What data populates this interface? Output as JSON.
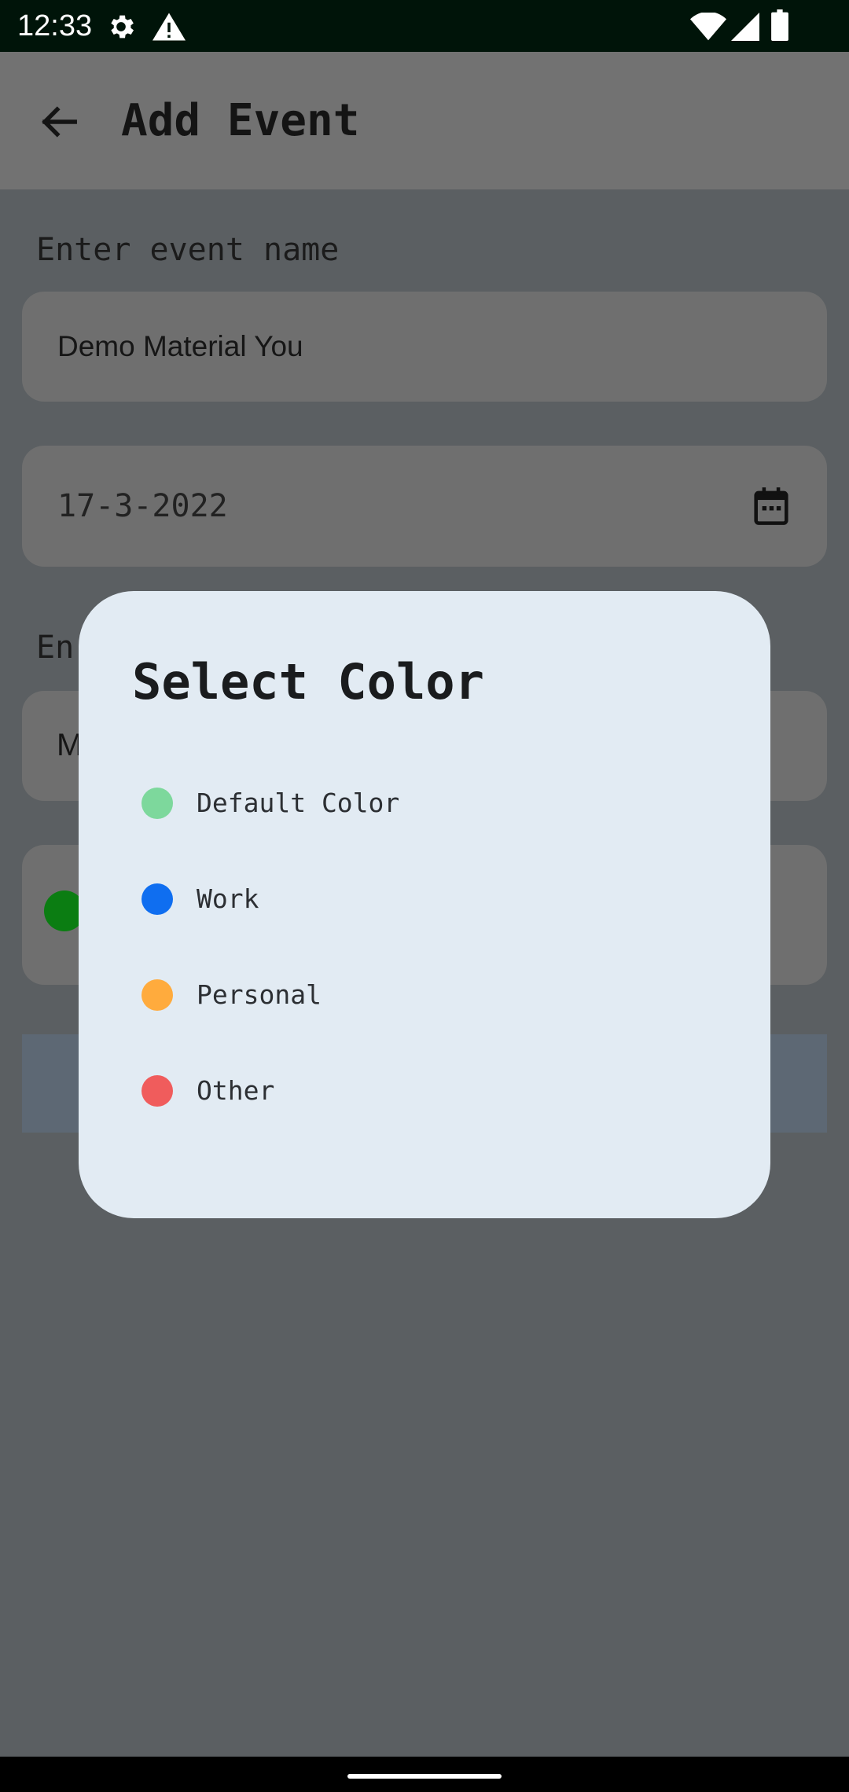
{
  "status_bar": {
    "time": "12:33",
    "icons": [
      "gear-icon",
      "warning-icon",
      "wifi-icon",
      "signal-icon",
      "battery-icon"
    ]
  },
  "app_bar": {
    "title": "Add Event",
    "back_icon": "arrow-left-icon"
  },
  "form": {
    "event_name": {
      "label": "Enter event name",
      "value": "Demo Material You"
    },
    "date": {
      "value": "17-3-2022",
      "icon": "calendar-icon"
    },
    "second_field": {
      "label_partial": "En",
      "value_partial": "M"
    },
    "selected_color": "#0b7d12"
  },
  "dialog": {
    "title": "Select Color",
    "options": [
      {
        "label": "Default Color",
        "color": "#7dd89c"
      },
      {
        "label": "Work",
        "color": "#0f6ef0"
      },
      {
        "label": "Personal",
        "color": "#ffab3d"
      },
      {
        "label": "Other",
        "color": "#f05c5c"
      }
    ]
  },
  "colors": {
    "status_bar": "#001409",
    "scrim_background": "#5b5f62",
    "dialog_surface": "#e2ebf3"
  }
}
